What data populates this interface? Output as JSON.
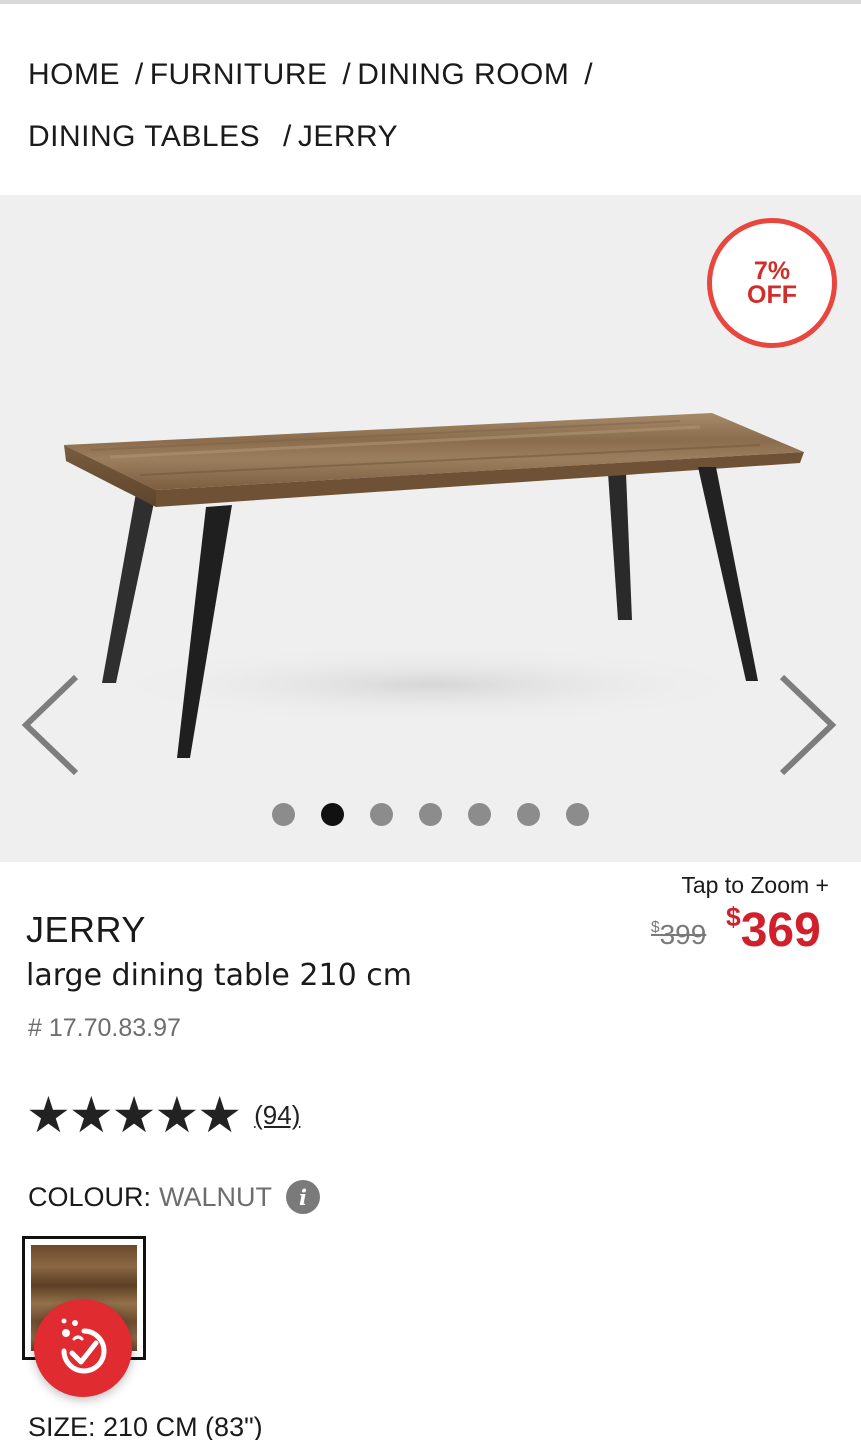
{
  "breadcrumb": {
    "home": "HOME",
    "furniture": "FURNITURE",
    "dining_room": "DINING ROOM",
    "dining_tables": "DINING TABLES",
    "current": "JERRY",
    "separator": "/"
  },
  "gallery": {
    "badge_percent": "7%",
    "badge_off": "OFF",
    "dot_count": 7,
    "active_dot": 2
  },
  "zoom_label": "Tap to Zoom +",
  "price": {
    "currency": "$",
    "old": "399",
    "new": "369"
  },
  "product": {
    "name": "JERRY",
    "description": "large dining table 210 cm",
    "sku": "# 17.70.83.97"
  },
  "rating": {
    "stars": "★★★★★",
    "value": 5,
    "review_count": "(94)"
  },
  "colour": {
    "label": "COLOUR:",
    "value": "WALNUT",
    "info_icon": "i"
  },
  "size": {
    "label": "SIZE: 210 CM (83\")"
  },
  "colors": {
    "sale_red": "#d0202c",
    "badge_border": "#e8473d",
    "fab_red": "#e02b31",
    "gallery_bg": "#efefef"
  },
  "icons": {
    "prev": "chevron-left-icon",
    "next": "chevron-right-icon",
    "info": "info-icon",
    "fab": "loyalty-badge-icon"
  }
}
